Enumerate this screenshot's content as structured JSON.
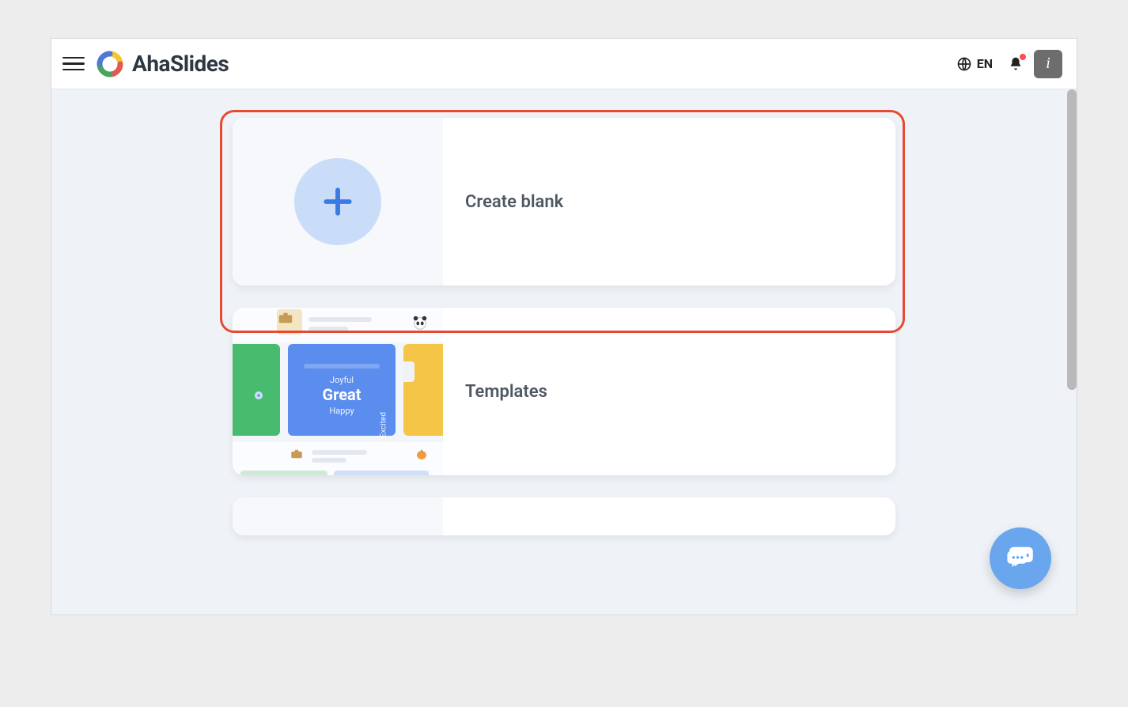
{
  "header": {
    "brand_name": "AhaSlides",
    "language_label": "EN"
  },
  "cards": {
    "create_blank": {
      "title": "Create blank"
    },
    "templates": {
      "title": "Templates",
      "thumb": {
        "joyful": "Joyful",
        "great": "Great",
        "happy": "Happy",
        "excited": "Excited"
      }
    }
  },
  "info_button_label": "i"
}
